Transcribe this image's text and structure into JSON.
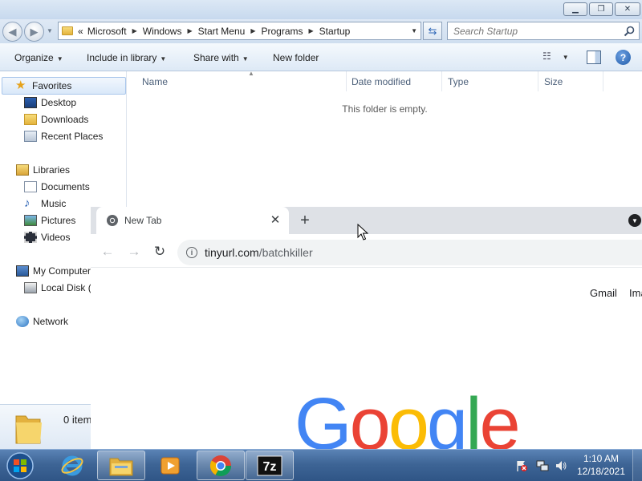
{
  "explorer": {
    "address": {
      "overflow": "«",
      "crumbs": [
        "Microsoft",
        "Windows",
        "Start Menu",
        "Programs",
        "Startup"
      ]
    },
    "search": {
      "placeholder": "Search Startup"
    },
    "commands": {
      "organize": "Organize",
      "include_in_library": "Include in library",
      "share_with": "Share with",
      "new_folder": "New folder"
    },
    "nav": {
      "favorites": "Favorites",
      "desktop": "Desktop",
      "downloads": "Downloads",
      "recent_places": "Recent Places",
      "libraries": "Libraries",
      "documents": "Documents",
      "music": "Music",
      "pictures": "Pictures",
      "videos": "Videos",
      "computer": "My Computer",
      "local_disk": "Local Disk (",
      "network": "Network"
    },
    "columns": [
      "Name",
      "Date modified",
      "Type",
      "Size"
    ],
    "empty_message": "This folder is empty.",
    "details": {
      "item_count": "0 item"
    }
  },
  "chrome": {
    "tab_title": "New Tab",
    "url_host": "tinyurl.com",
    "url_path": "/batchkiller",
    "links": {
      "gmail": "Gmail",
      "images": "Ima"
    },
    "logo_letters": [
      "G",
      "o",
      "o",
      "g",
      "l",
      "e"
    ],
    "logo_colors": [
      "#4285F4",
      "#EA4335",
      "#FBBC05",
      "#4285F4",
      "#34A853",
      "#EA4335"
    ]
  },
  "taskbar": {
    "time": "1:10 AM",
    "date": "12/18/2021",
    "items": [
      "internet-explorer",
      "windows-explorer",
      "media-player",
      "chrome",
      "7zip"
    ]
  }
}
